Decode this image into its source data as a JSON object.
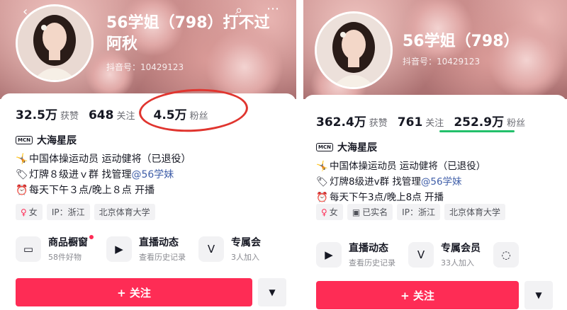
{
  "left": {
    "name_line1": "56学姐（798）打不过",
    "name_line2": "阿秋",
    "douyin_id": "抖音号：10429123",
    "stats": [
      {
        "num": "32.5万",
        "label": "获赞"
      },
      {
        "num": "648",
        "label": "关注"
      },
      {
        "num": "4.5万",
        "label": "粉丝"
      }
    ],
    "org_badge": "MCN",
    "org": "大海星辰",
    "bio": [
      {
        "icon": "🤸",
        "text": "中国体操运动员 运动健将（已退役）"
      },
      {
        "icon": "🏷",
        "text": "灯牌８级进ｖ群 找管理",
        "mention": "@56学妹"
      },
      {
        "icon": "⏰",
        "text": "每天下午３点/晚上８点 开播"
      }
    ],
    "tags": [
      {
        "icon": "♀",
        "text": "女"
      },
      {
        "icon": "",
        "text": "IP：浙江"
      },
      {
        "icon": "",
        "text": "北京体育大学"
      }
    ],
    "features": [
      {
        "icon": "cart-icon",
        "title": "商品橱窗",
        "sub": "58件好物",
        "dot": true
      },
      {
        "icon": "live-tv-icon",
        "title": "直播动态",
        "sub": "查看历史记录",
        "dot": false
      },
      {
        "icon": "vip-icon",
        "title": "专属会",
        "sub": "3人加入",
        "dot": false
      }
    ],
    "follow_label": "+ 关注",
    "more_label": "▼",
    "annotation_color": "#e0352f"
  },
  "right": {
    "name_line1": "56学姐（798）",
    "douyin_id": "抖音号：10429123",
    "stats": [
      {
        "num": "362.4万",
        "label": "获赞"
      },
      {
        "num": "761",
        "label": "关注"
      },
      {
        "num": "252.9万",
        "label": "粉丝"
      }
    ],
    "org_badge": "MCN",
    "org": "大海星辰",
    "bio": [
      {
        "icon": "🤸",
        "text": "中国体操运动员 运动健将（已退役）"
      },
      {
        "icon": "🏷",
        "text": "灯牌8级进v群 找管理",
        "mention": "@56学妹"
      },
      {
        "icon": "⏰",
        "text": "每天下午3点/晚上8点 开播"
      }
    ],
    "tags": [
      {
        "icon": "♀",
        "text": "女"
      },
      {
        "icon": "▣",
        "text": "已实名"
      },
      {
        "icon": "",
        "text": "IP：浙江"
      },
      {
        "icon": "",
        "text": "北京体育大学"
      }
    ],
    "features": [
      {
        "icon": "live-tv-icon",
        "title": "直播动态",
        "sub": "查看历史记录",
        "dot": false
      },
      {
        "icon": "vip-icon",
        "title": "专属会员",
        "sub": "33人加入",
        "dot": false
      },
      {
        "icon": "chat-icon",
        "title": "",
        "sub": "",
        "dot": false
      }
    ],
    "follow_label": "+ 关注",
    "more_label": "▼",
    "annotation_color": "#23c06b"
  },
  "colors": {
    "accent": "#fe2c55",
    "mention": "#3f5ea8"
  }
}
